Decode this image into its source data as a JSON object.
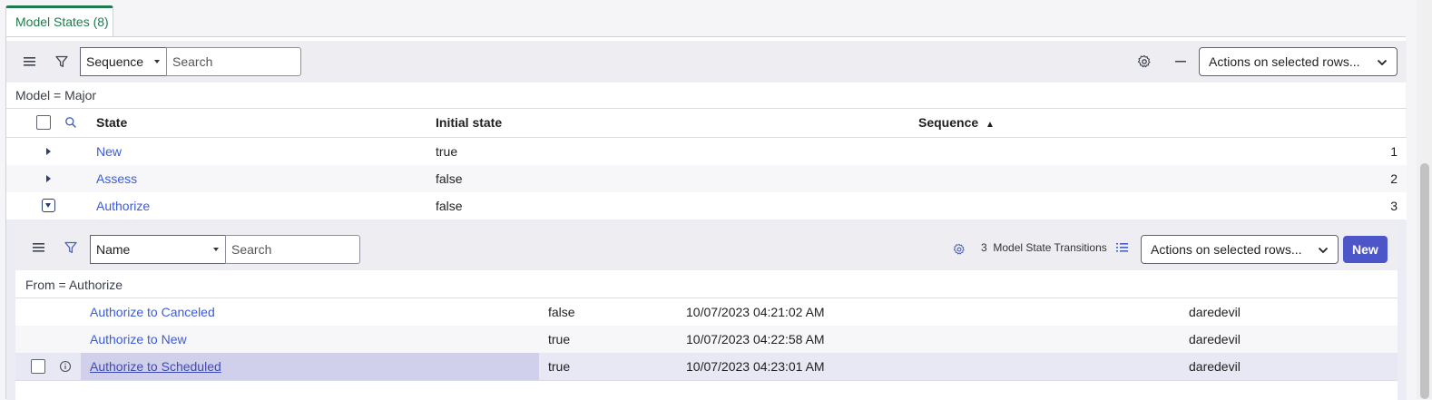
{
  "tab": {
    "label": "Model States (8)"
  },
  "toolbar": {
    "field_select": "Sequence",
    "search_placeholder": "Search",
    "actions_label": "Actions on selected rows..."
  },
  "filter": {
    "text": "Model = Major"
  },
  "table": {
    "columns": [
      "State",
      "Initial state",
      "Sequence"
    ],
    "sort_indicator": "▲",
    "rows": [
      {
        "state": "New",
        "initial": "true",
        "sequence": "1"
      },
      {
        "state": "Assess",
        "initial": "false",
        "sequence": "2"
      },
      {
        "state": "Authorize",
        "initial": "false",
        "sequence": "3"
      }
    ]
  },
  "related": {
    "field_select": "Name",
    "search_placeholder": "Search",
    "count": "3",
    "count_label": "Model State Transitions",
    "actions_label": "Actions on selected rows...",
    "new_label": "New",
    "filter_text": "From = Authorize",
    "rows": [
      {
        "name": "Authorize to Canceled",
        "flag": "false",
        "updated": "10/07/2023 04:21:02 AM",
        "user": "daredevil"
      },
      {
        "name": "Authorize to New",
        "flag": "true",
        "updated": "10/07/2023 04:22:58 AM",
        "user": "daredevil"
      },
      {
        "name": "Authorize to Scheduled",
        "flag": "true",
        "updated": "10/07/2023 04:23:01 AM",
        "user": "daredevil"
      }
    ]
  },
  "colors": {
    "accent_green": "#1f7a4d",
    "link_blue": "#3b5bdb",
    "new_button": "#4c56c9",
    "selected_row": "#e8e8f4"
  }
}
